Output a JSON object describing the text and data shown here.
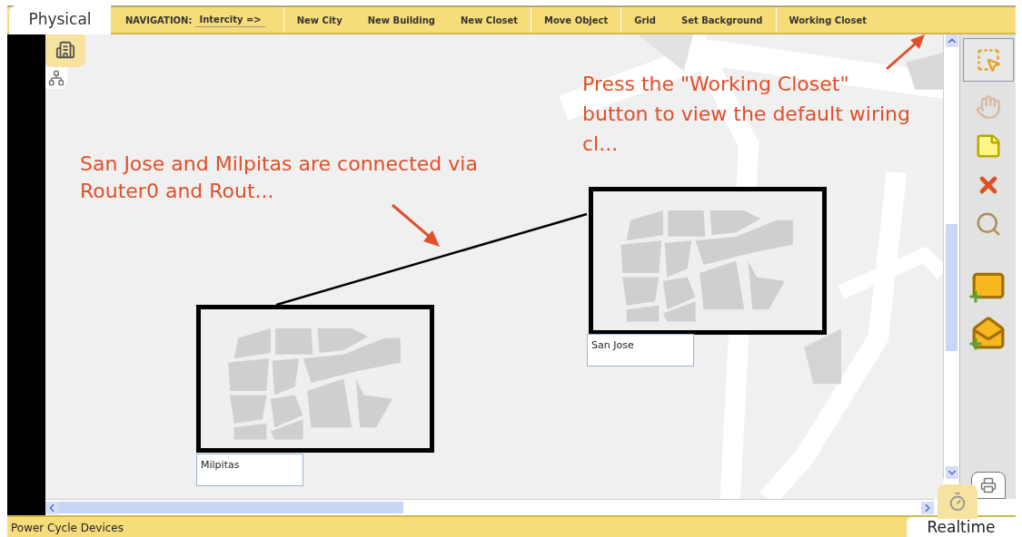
{
  "tab": {
    "label": "Physical"
  },
  "navigation": {
    "label": "NAVIGATION:",
    "value": "Intercity =>"
  },
  "menu": [
    "New City",
    "New Building",
    "New Closet",
    "Move Object",
    "Grid",
    "Set Background",
    "Working Closet"
  ],
  "annotations": [
    {
      "text": "Press the \"Working Closet\" button to view the default wiring cl..."
    },
    {
      "text": "San Jose and Milpitas are connected via Router0 and Rout..."
    }
  ],
  "cities": [
    {
      "name": "San Jose"
    },
    {
      "name": "Milpitas"
    }
  ],
  "status_bar": {
    "text": "Power Cycle Devices",
    "mode": "Realtime"
  }
}
